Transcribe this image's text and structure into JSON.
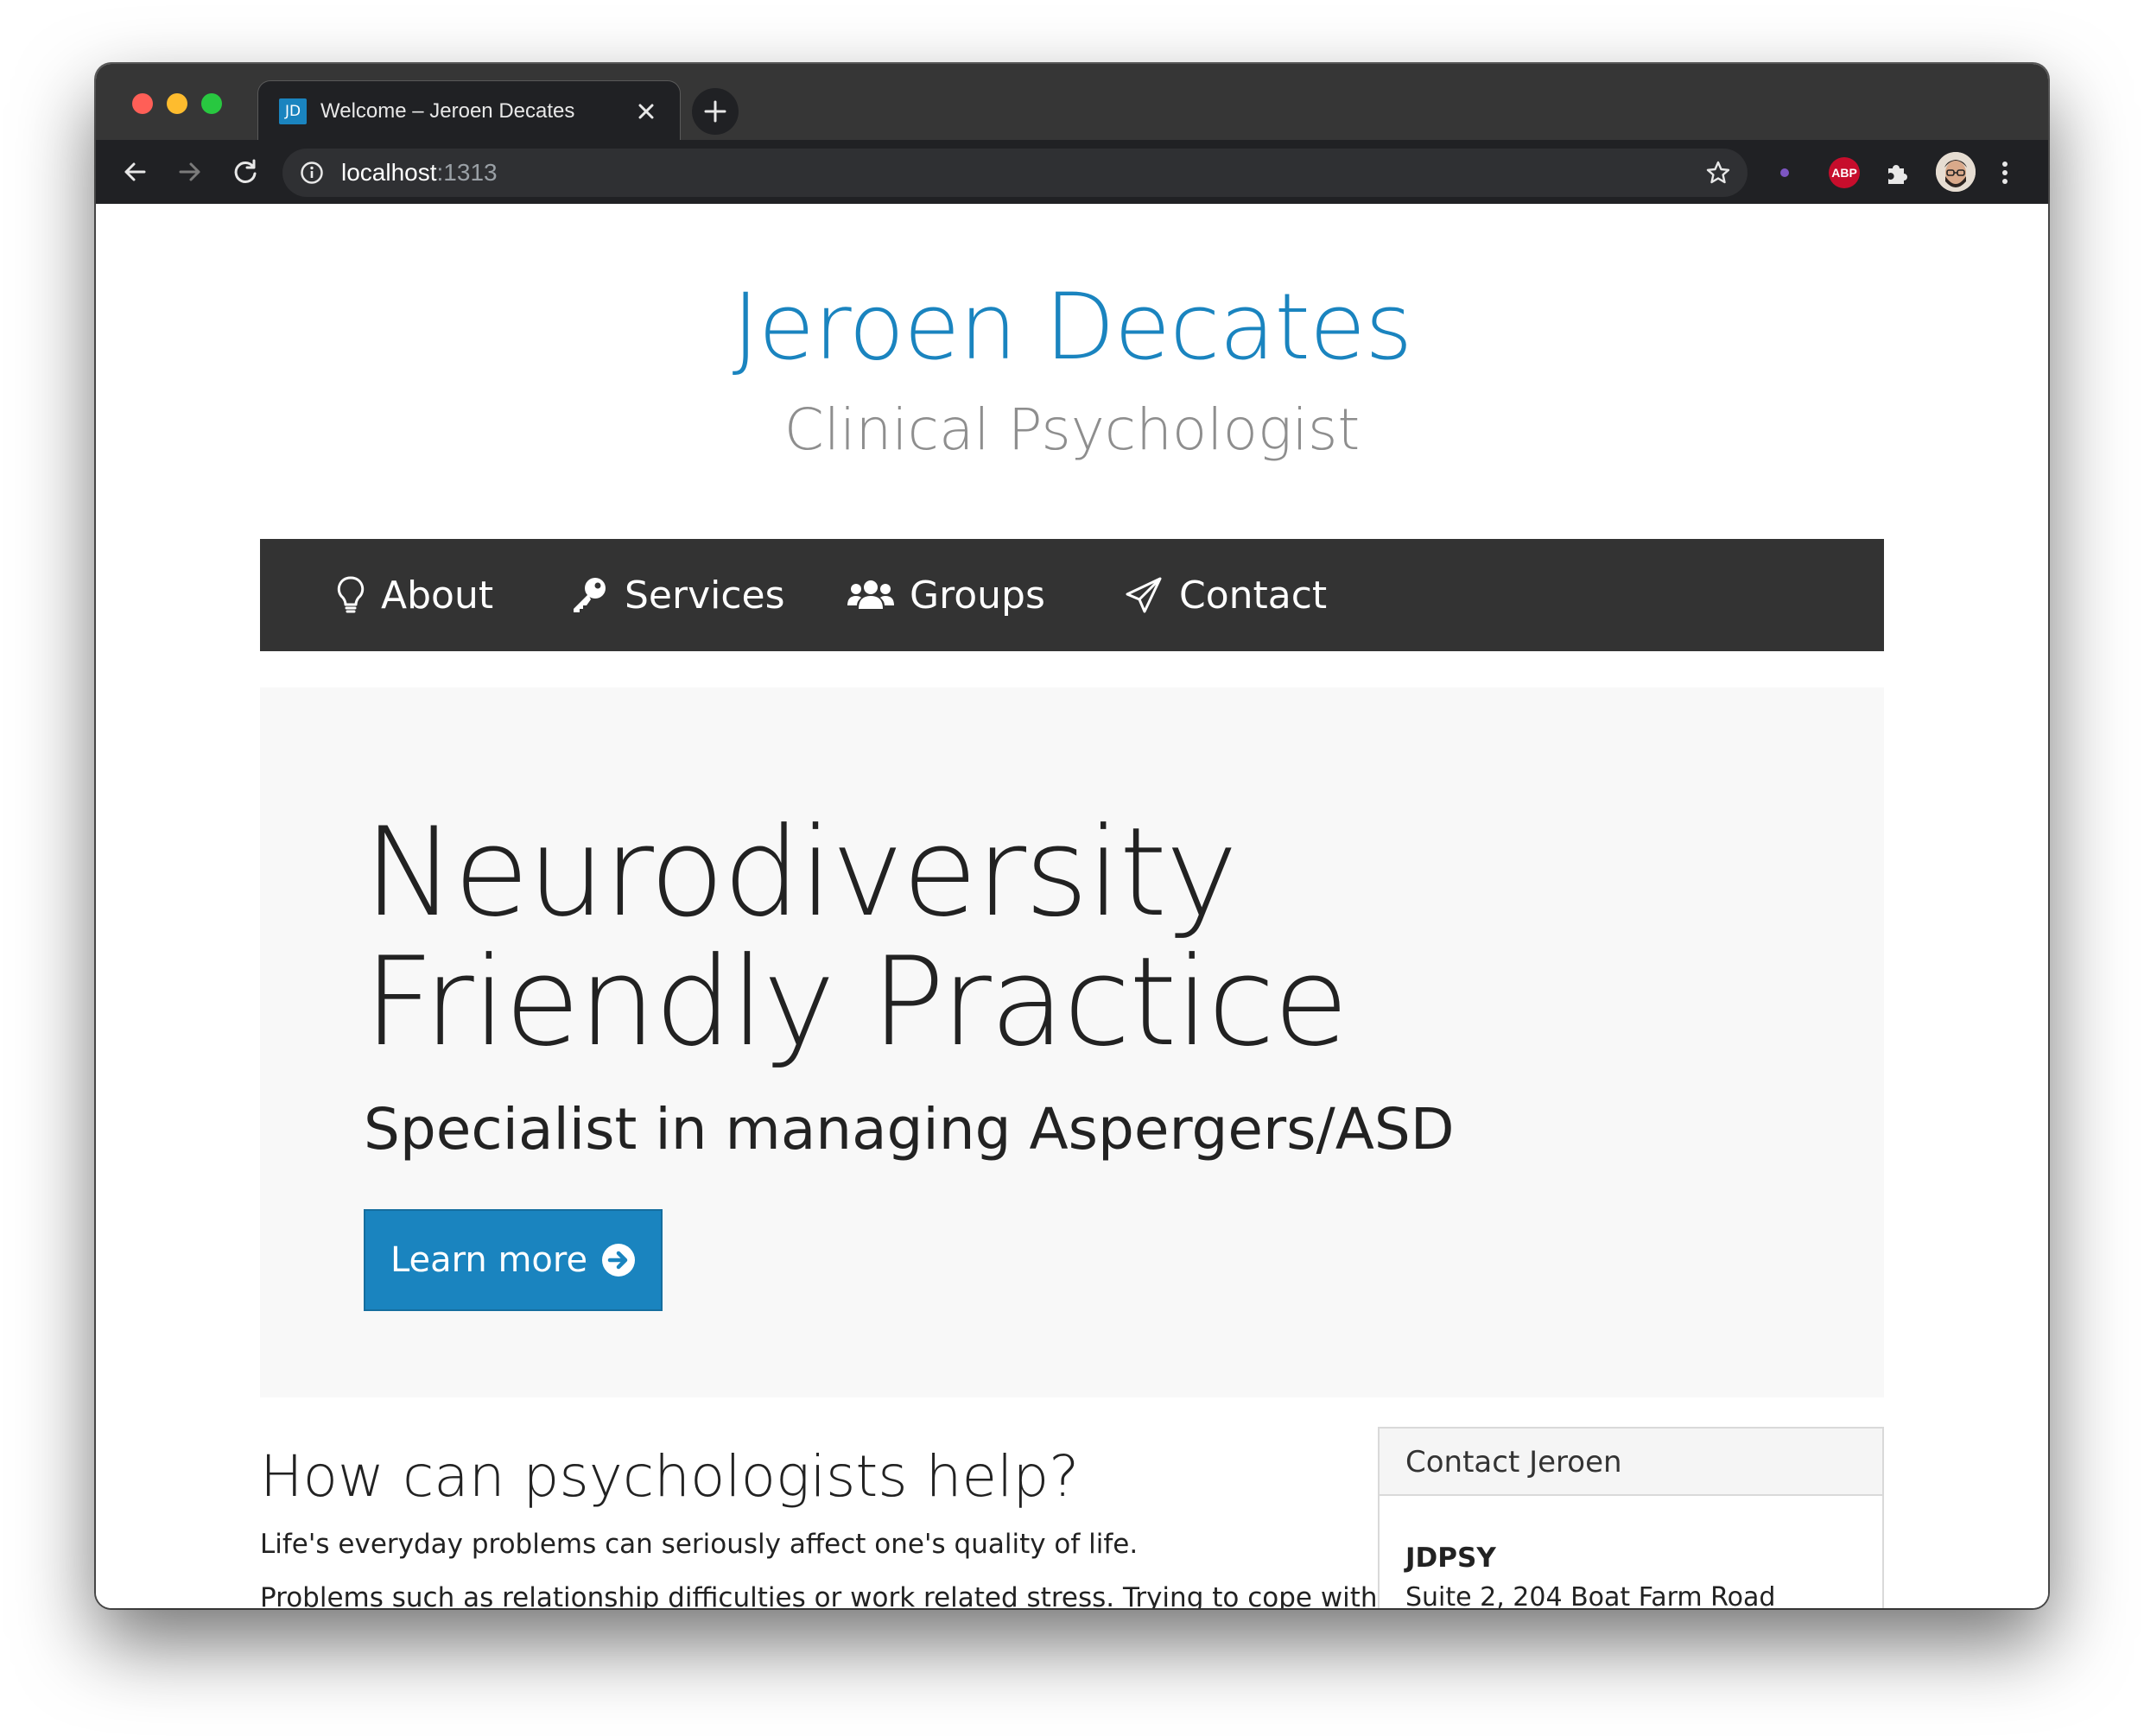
{
  "browser": {
    "tab_title": "Welcome – Jeroen Decates",
    "favicon_text": "JD",
    "url_host": "localhost",
    "url_port": ":1313",
    "extensions": [
      "extension-dot-icon",
      "adblock-plus-icon",
      "puzzle-icon"
    ],
    "abp_label": "ABP"
  },
  "site": {
    "title": "Jeroen Decates",
    "subtitle": "Clinical Psychologist",
    "accent_color": "#1a84bf"
  },
  "nav": {
    "items": [
      {
        "label": "About",
        "icon": "lightbulb-icon"
      },
      {
        "label": "Services",
        "icon": "key-icon"
      },
      {
        "label": "Groups",
        "icon": "users-icon"
      },
      {
        "label": "Contact",
        "icon": "paper-plane-icon"
      }
    ]
  },
  "hero": {
    "title": "Neurodiversity Friendly Practice",
    "subtitle": "Specialist in managing Aspergers/ASD",
    "button_label": "Learn more",
    "button_icon": "arrow-circle-right-icon"
  },
  "main": {
    "heading": "How can psychologists help?",
    "paragraph_1": "Life's everyday problems can seriously affect one's quality of life.",
    "paragraph_2": "Problems such as relationship difficulties or work related stress. Trying to cope with"
  },
  "contact_card": {
    "header": "Contact Jeroen",
    "org": "JDPSY",
    "address": "Suite 2, 204 Boat Farm Road"
  }
}
